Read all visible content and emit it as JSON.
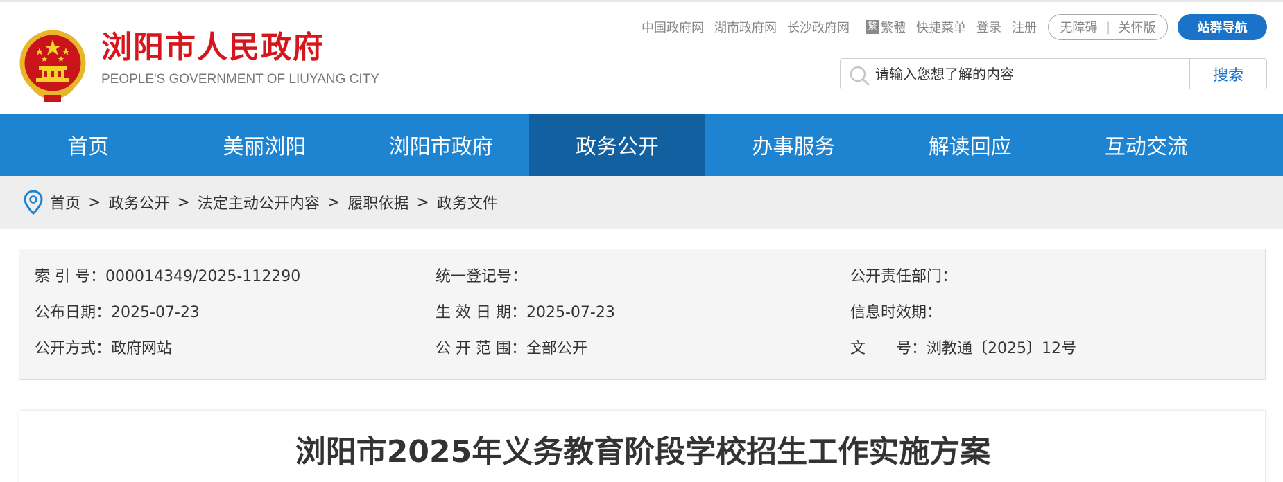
{
  "header": {
    "site_title": "浏阳市人民政府",
    "site_subtitle": "PEOPLE'S GOVERNMENT OF LIUYANG CITY",
    "top_links": [
      "中国政府网",
      "湖南政府网",
      "长沙政府网"
    ],
    "traditional_badge": "繁",
    "traditional_label": "繁體",
    "quick_menu": "快捷菜单",
    "login": "登录",
    "register": "注册",
    "accessible": "无障碍",
    "elder_mode": "关怀版",
    "site_nav": "站群导航",
    "search_placeholder": "请输入您想了解的内容",
    "search_button": "搜索"
  },
  "nav": {
    "items": [
      "首页",
      "美丽浏阳",
      "浏阳市政府",
      "政务公开",
      "办事服务",
      "解读回应",
      "互动交流"
    ],
    "active": "政务公开"
  },
  "breadcrumb": [
    "首页",
    "政务公开",
    "法定主动公开内容",
    "履职依据",
    "政务文件"
  ],
  "breadcrumb_separator": ">",
  "meta": {
    "index_label": "索 引 号：",
    "index_value": "000014349/2025-112290",
    "reg_label": "统一登记号：",
    "reg_value": "",
    "dept_label": "公开责任部门：",
    "dept_value": "",
    "publish_label": "公布日期：",
    "publish_value": "2025-07-23",
    "effective_label": "生 效 日 期：",
    "effective_value": "2025-07-23",
    "validity_label": "信息时效期：",
    "validity_value": "",
    "method_label": "公开方式：",
    "method_value": "政府网站",
    "scope_label": "公 开 范 围：",
    "scope_value": "全部公开",
    "docno_label": "文　　号：",
    "docno_value": "浏教通〔2025〕12号"
  },
  "article": {
    "title": "浏阳市2025年义务教育阶段学校招生工作实施方案"
  },
  "colors": {
    "brand_red": "#d7151c",
    "nav_blue": "#1e83d1",
    "nav_active": "#12609f",
    "pill_blue": "#1a73c9"
  }
}
